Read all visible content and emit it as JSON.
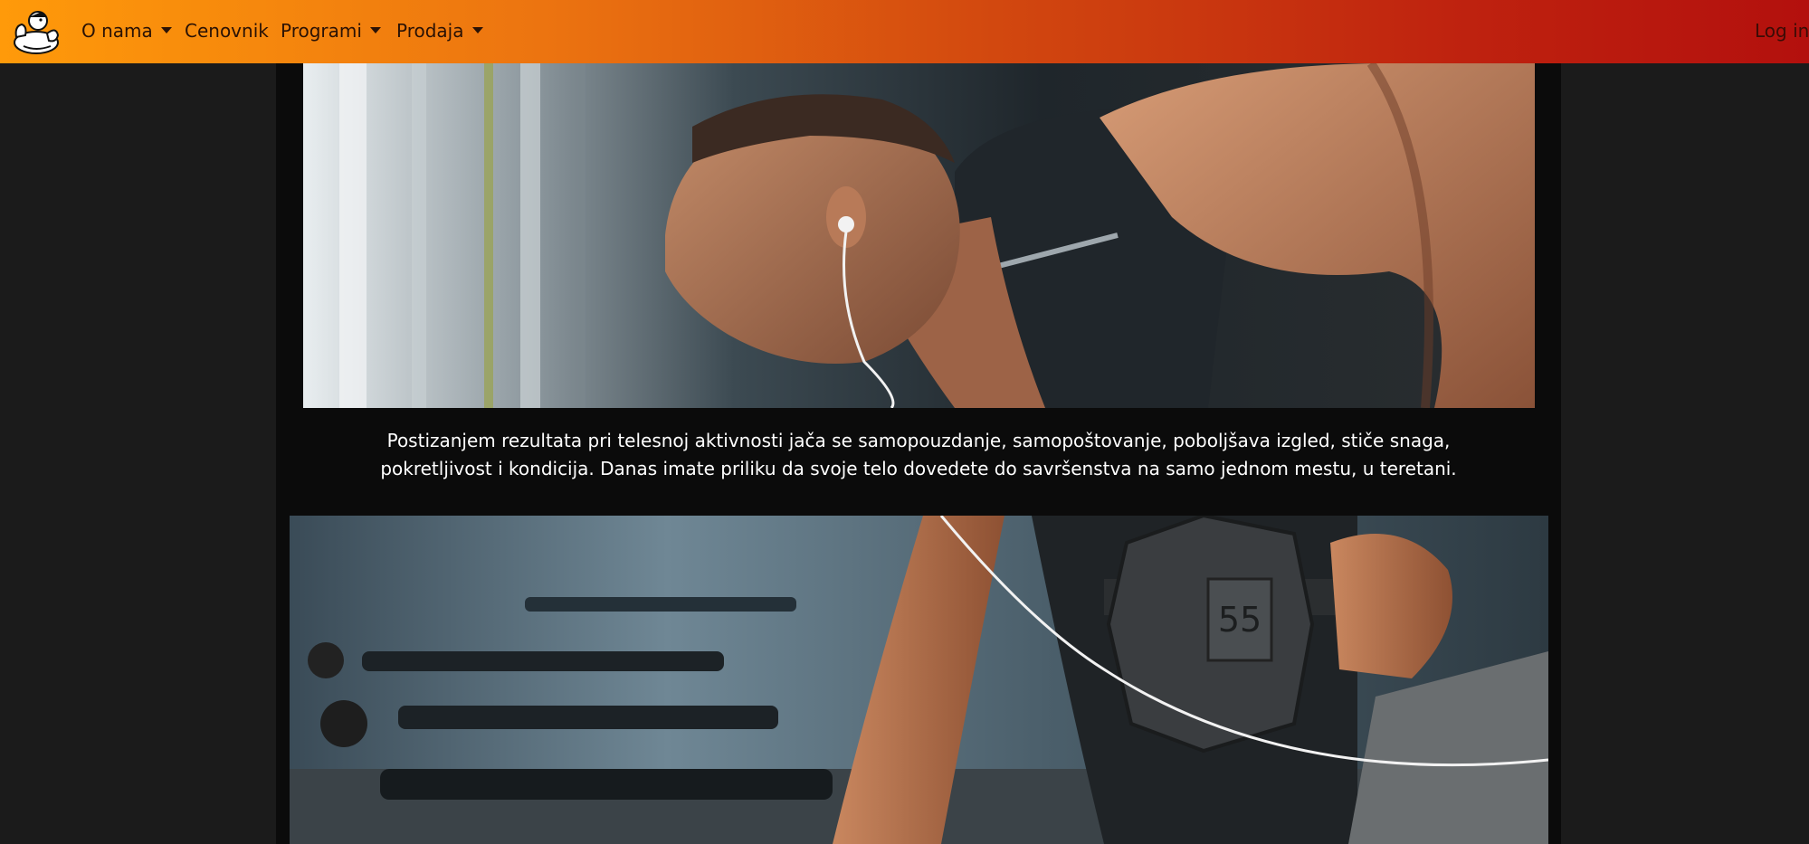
{
  "nav": {
    "items": [
      {
        "label": "O nama",
        "dropdown": true
      },
      {
        "label": "Cenovnik",
        "dropdown": false
      },
      {
        "label": "Programi",
        "dropdown": true
      },
      {
        "label": "Prodaja",
        "dropdown": true
      }
    ],
    "login_label": "Log in"
  },
  "logo": {
    "icon": "muscle-mascot-icon"
  },
  "main": {
    "hero_image": {
      "subject": "man training with headphones in gym"
    },
    "caption": "Postizanjem rezultata pri telesnoj aktivnosti jača se samopouzdanje, samopoštovanje, poboljšava izgled, stiče snaga, pokretljivost i kondicija. Danas imate priliku da svoje telo dovedete do savršenstva na samo jednom mestu, u teretani.",
    "second_image": {
      "subject": "dumbbell row in gym",
      "dumbbell_text": "55"
    }
  },
  "colors": {
    "navbar_start": "#ff9a0a",
    "navbar_end": "#b3100d",
    "page_bg": "#1b1b1b",
    "content_bg": "#0b0b0b"
  }
}
